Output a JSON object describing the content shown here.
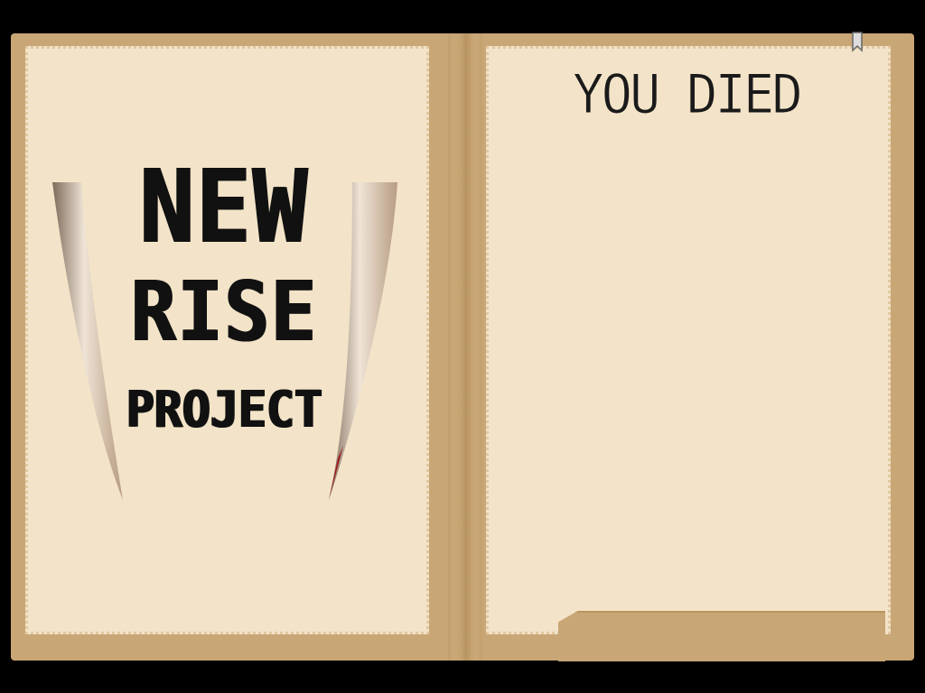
{
  "screen": {
    "headline": "YOU DIED"
  },
  "logo": {
    "line1": "NEW",
    "line2": "RISE",
    "line3": "PROJECT"
  },
  "icons": {
    "bookmark": "bookmark-icon",
    "claw": "claw-icon"
  },
  "colors": {
    "background": "#000000",
    "book_cover": "#c9a676",
    "page": "#f3e3c8",
    "text": "#111111",
    "blood": "#9c1b1b"
  }
}
